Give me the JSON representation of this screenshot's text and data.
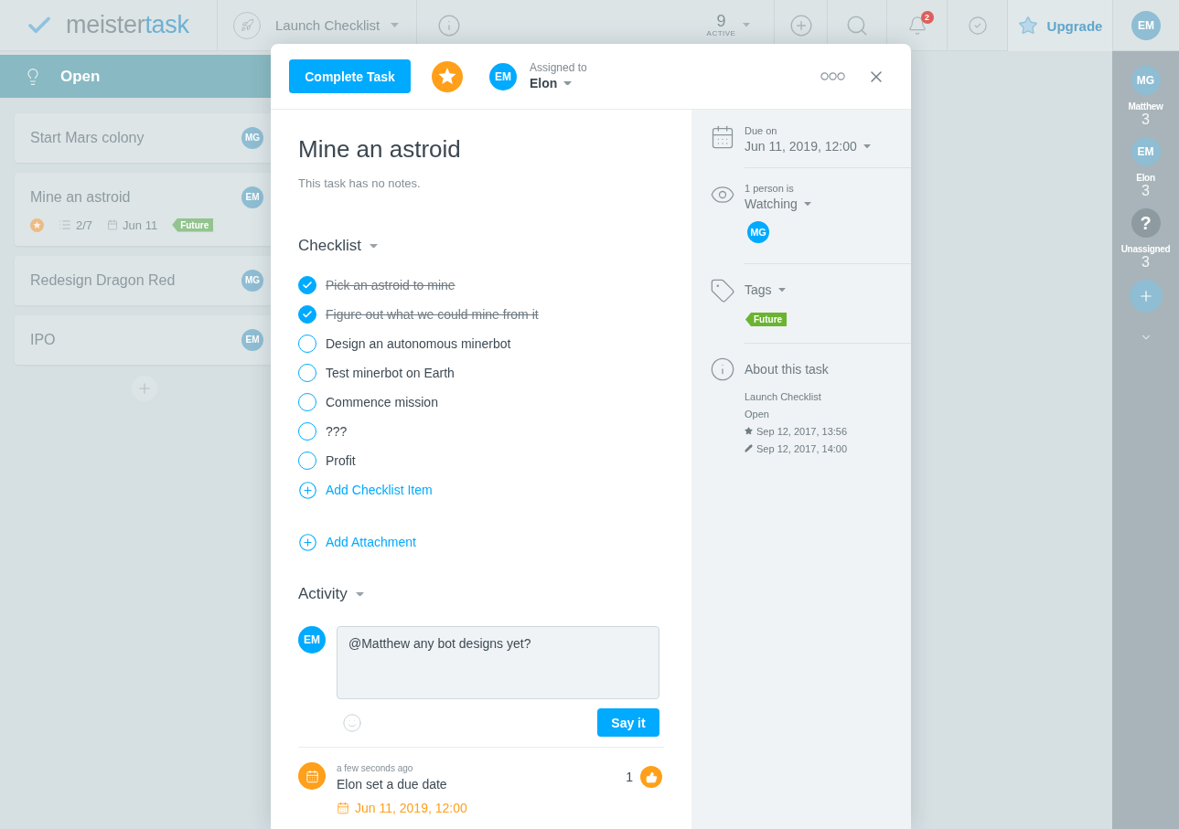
{
  "top_bar": {
    "logo": {
      "prefix": "meister",
      "suffix": "task"
    },
    "project": "Launch Checklist",
    "active": {
      "count": "9",
      "label": "ACTIVE"
    },
    "notifications": "2",
    "upgrade_button": "Upgrade",
    "user_avatar": "EM"
  },
  "board": {
    "section": "Open",
    "cards": [
      {
        "title": "Start Mars colony",
        "assignee": "MG",
        "starred": false
      },
      {
        "title": "Mine an astroid",
        "assignee": "EM",
        "starred": true,
        "checklist": "2/7",
        "due": "Jun 11",
        "tags": [
          "Future"
        ]
      },
      {
        "title": "Redesign Dragon Red",
        "assignee": "MG",
        "starred": false
      },
      {
        "title": "IPO",
        "assignee": "EM",
        "starred": false
      }
    ]
  },
  "team_panel": {
    "members": [
      {
        "kind": "person",
        "avatar": "MG",
        "name": "Matthew",
        "count": "3"
      },
      {
        "kind": "person",
        "avatar": "EM",
        "name": "Elon",
        "count": "3"
      },
      {
        "kind": "unassigned",
        "avatar": "?",
        "name": "Unassigned",
        "count": "3"
      }
    ]
  },
  "task_dialog": {
    "complete_button": "Complete Task",
    "starred": true,
    "assignee": {
      "avatar": "EM",
      "label": "Assigned to",
      "name": "Elon"
    },
    "title": "Mine an astroid",
    "notes_placeholder": "This task has no notes.",
    "checklist": {
      "heading": "Checklist",
      "items": [
        {
          "text": "Pick an astroid to mine",
          "checked": true
        },
        {
          "text": "Figure out what we could mine from it",
          "checked": true
        },
        {
          "text": "Design an autonomous minerbot",
          "checked": false
        },
        {
          "text": "Test minerbot on Earth",
          "checked": false
        },
        {
          "text": "Commence mission",
          "checked": false
        },
        {
          "text": "???",
          "checked": false
        },
        {
          "text": "Profit",
          "checked": false
        }
      ],
      "add_label": "Add Checklist Item"
    },
    "add_attachment": "Add Attachment",
    "activity": {
      "heading": "Activity",
      "comment": {
        "avatar": "EM",
        "value": "@Matthew any bot designs yet?"
      },
      "submit_button": "Say it",
      "entries": [
        {
          "kind": "due_date",
          "time": "a few seconds ago",
          "text": "Elon set a due date",
          "likes": "1",
          "detail": "Jun 11, 2019, 12:00"
        }
      ]
    },
    "details": {
      "due": {
        "label": "Due on",
        "value": "Jun 11, 2019, 12:00"
      },
      "watchers": {
        "label": "1 person is",
        "value": "Watching",
        "avatars": [
          "MG"
        ]
      },
      "tags": {
        "heading": "Tags",
        "items": [
          "Future"
        ]
      },
      "about": {
        "heading": "About this task",
        "project": "Launch Checklist",
        "section": "Open",
        "created": "Sep 12, 2017, 13:56",
        "edited": "Sep 12, 2017, 14:00"
      }
    }
  }
}
